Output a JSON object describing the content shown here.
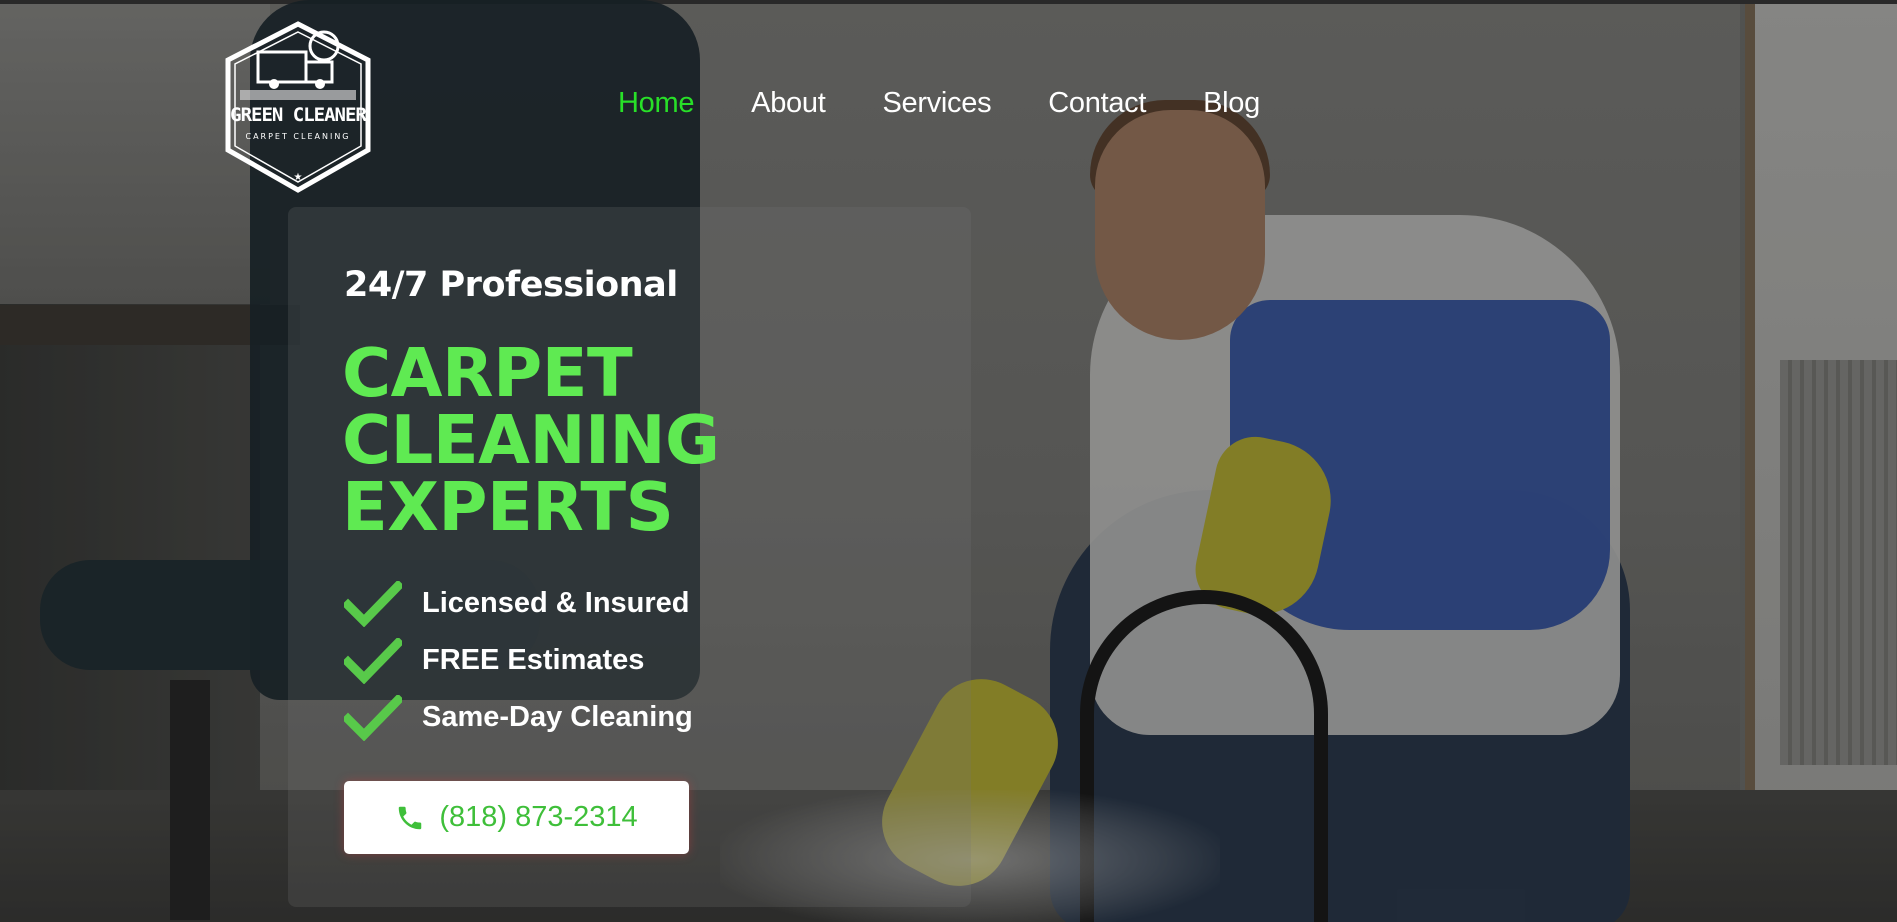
{
  "logo": {
    "brand": "GREEN CLEANER",
    "tagline": "CARPET CLEANING"
  },
  "nav": {
    "items": [
      {
        "label": "Home",
        "active": true
      },
      {
        "label": "About",
        "active": false
      },
      {
        "label": "Services",
        "active": false
      },
      {
        "label": "Contact",
        "active": false
      },
      {
        "label": "Blog",
        "active": false
      }
    ]
  },
  "hero": {
    "eyebrow": "24/7 Professional",
    "headline_lines": [
      "CARPET",
      "CLEANING",
      "EXPERTS"
    ],
    "features": [
      "Licensed & Insured",
      "FREE Estimates",
      "Same-Day Cleaning"
    ],
    "phone_label": "(818) 873-2314"
  },
  "colors": {
    "accent_green": "#5fea52",
    "nav_active": "#28e028",
    "phone_text": "#3fbf3a"
  },
  "icons": {
    "feature": "checkmark-icon",
    "phone": "phone-icon"
  }
}
